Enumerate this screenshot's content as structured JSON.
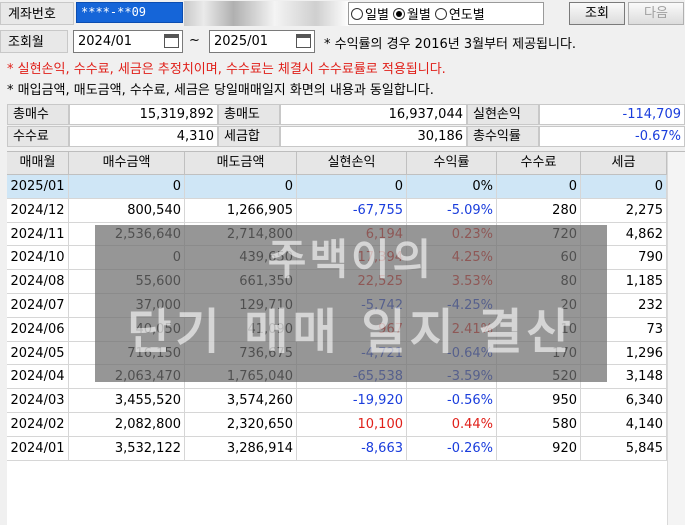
{
  "account": {
    "label": "계좌번호",
    "value": "****-**09"
  },
  "period_options": [
    {
      "label": "일별",
      "selected": false
    },
    {
      "label": "월별",
      "selected": true
    },
    {
      "label": "연도별",
      "selected": false
    }
  ],
  "buttons": {
    "search": "조회",
    "next": "다음"
  },
  "query": {
    "label": "조회월",
    "from": "2024/01",
    "sep": "~",
    "to": "2025/01",
    "note": "* 수익률의 경우 2016년 3월부터 제공됩니다."
  },
  "notices": {
    "line1": "* 실현손익, 수수료, 세금은 추정치이며, 수수료는 체결시 수수료률로 적용됩니다.",
    "line2": "* 매입금액, 매도금액, 수수료, 세금은 당일매매일지 화면의 내용과 동일합니다."
  },
  "summary": {
    "total_buy_label": "총매수",
    "total_buy": "15,319,892",
    "total_sell_label": "총매도",
    "total_sell": "16,937,044",
    "realized_label": "실현손익",
    "realized": "-114,709",
    "fee_label": "수수료",
    "fee": "4,310",
    "tax_label": "세금합",
    "tax": "30,186",
    "total_return_label": "총수익률",
    "total_return": "-0.67%"
  },
  "table": {
    "headers": [
      "매매월",
      "매수금액",
      "매도금액",
      "실현손익",
      "수익률",
      "수수료",
      "세금"
    ],
    "rows": [
      {
        "month": "2025/01",
        "buy": "0",
        "sell": "0",
        "pnl": "0",
        "rate": "0%",
        "fee": "0",
        "tax": "0",
        "sign": "zero"
      },
      {
        "month": "2024/12",
        "buy": "800,540",
        "sell": "1,266,905",
        "pnl": "-67,755",
        "rate": "-5.09%",
        "fee": "280",
        "tax": "2,275",
        "sign": "neg"
      },
      {
        "month": "2024/11",
        "buy": "2,536,640",
        "sell": "2,714,800",
        "pnl": "6,194",
        "rate": "0.23%",
        "fee": "720",
        "tax": "4,862",
        "sign": "pos"
      },
      {
        "month": "2024/10",
        "buy": "0",
        "sell": "439,650",
        "pnl": "17,394",
        "rate": "4.25%",
        "fee": "60",
        "tax": "790",
        "sign": "pos"
      },
      {
        "month": "2024/08",
        "buy": "55,600",
        "sell": "661,350",
        "pnl": "22,525",
        "rate": "3.53%",
        "fee": "80",
        "tax": "1,185",
        "sign": "pos"
      },
      {
        "month": "2024/07",
        "buy": "37,000",
        "sell": "129,710",
        "pnl": "-5,742",
        "rate": "-4.25%",
        "fee": "20",
        "tax": "232",
        "sign": "neg"
      },
      {
        "month": "2024/06",
        "buy": "40,050",
        "sell": "41,090",
        "pnl": "967",
        "rate": "2.41%",
        "fee": "10",
        "tax": "73",
        "sign": "pos"
      },
      {
        "month": "2024/05",
        "buy": "716,150",
        "sell": "736,675",
        "pnl": "-4,721",
        "rate": "-0.64%",
        "fee": "170",
        "tax": "1,296",
        "sign": "neg"
      },
      {
        "month": "2024/04",
        "buy": "2,063,470",
        "sell": "1,765,040",
        "pnl": "-65,538",
        "rate": "-3.59%",
        "fee": "520",
        "tax": "3,148",
        "sign": "neg"
      },
      {
        "month": "2024/03",
        "buy": "3,455,520",
        "sell": "3,574,260",
        "pnl": "-19,920",
        "rate": "-0.56%",
        "fee": "950",
        "tax": "6,340",
        "sign": "neg"
      },
      {
        "month": "2024/02",
        "buy": "2,082,800",
        "sell": "2,320,650",
        "pnl": "10,100",
        "rate": "0.44%",
        "fee": "580",
        "tax": "4,140",
        "sign": "pos"
      },
      {
        "month": "2024/01",
        "buy": "3,532,122",
        "sell": "3,286,914",
        "pnl": "-8,663",
        "rate": "-0.26%",
        "fee": "920",
        "tax": "5,845",
        "sign": "neg"
      }
    ]
  },
  "watermark": {
    "line1": "주백이의",
    "line2": "단기 매매 일지 결산"
  },
  "colors": {
    "negative": "#1a3ddc",
    "positive": "#e0201a",
    "selected_row": "#cfe6f6",
    "account_field": "#1565d8"
  }
}
